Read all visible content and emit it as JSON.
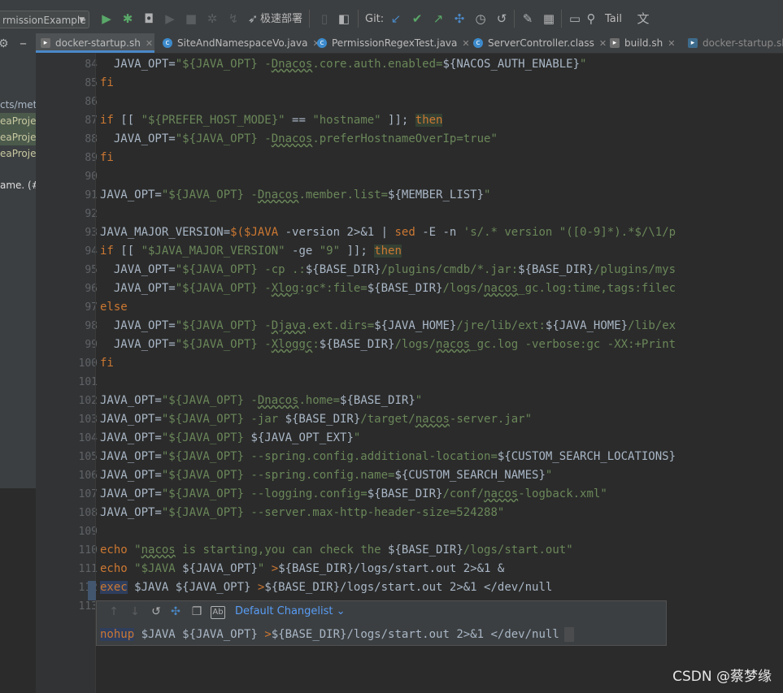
{
  "toolbar": {
    "run_config": "rmissionExample",
    "deploy_label": "极速部署",
    "git_label": "Git:",
    "tail_label": "Tail"
  },
  "project_pane": {
    "items": [
      "cts/met",
      "eaProjec",
      "eaProje",
      "eaProje",
      "ame. (#"
    ]
  },
  "tabs": [
    {
      "label": "docker-startup.sh",
      "icon": "shell-icon",
      "active": true
    },
    {
      "label": "SiteAndNamespaceVo.java",
      "icon": "class-icon",
      "active": false
    },
    {
      "label": "PermissionRegexTest.java",
      "icon": "test-class-icon",
      "active": false
    },
    {
      "label": "ServerController.class",
      "icon": "class-icon",
      "active": false
    },
    {
      "label": "build.sh",
      "icon": "shell-icon",
      "active": false
    },
    {
      "label": "docker-startup.sh",
      "icon": "shell-icon",
      "active": false
    }
  ],
  "line_numbers": [
    "84",
    "85",
    "86",
    "87",
    "88",
    "89",
    "90",
    "91",
    "92",
    "93",
    "94",
    "95",
    "96",
    "97",
    "98",
    "99",
    "100",
    "101",
    "102",
    "103",
    "104",
    "105",
    "106",
    "107",
    "108",
    "109",
    "110",
    "111",
    "112",
    "113"
  ],
  "popup": {
    "changelist_label": "Default Changelist",
    "diff_line": "nohup $JAVA ${JAVA_OPT} >${BASE_DIR}/logs/start.out 2>&1 </dev/null"
  },
  "watermark": "CSDN @蔡梦缘",
  "colors": {
    "editor_bg": "#2b2b2b",
    "keyword": "#cc7832",
    "string": "#6a8759",
    "text": "#a9b7c6",
    "link": "#589df6"
  }
}
